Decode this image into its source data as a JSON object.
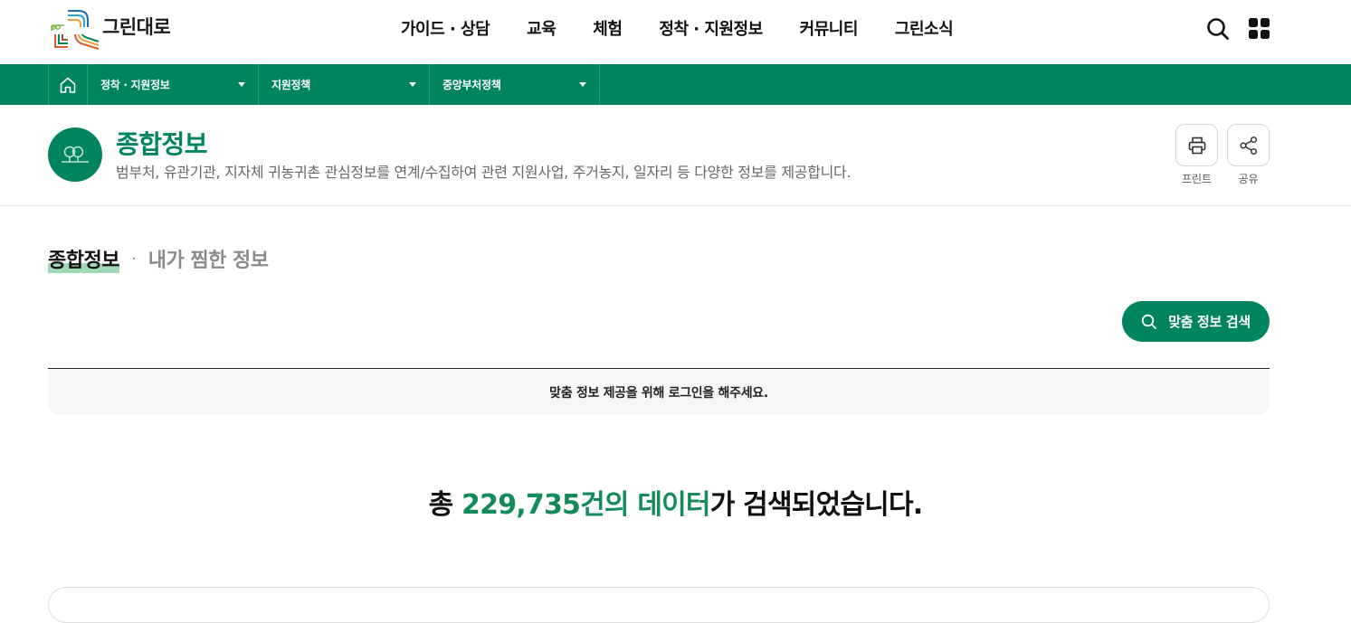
{
  "header": {
    "logo_text": "그린대로",
    "nav": [
      "가이드 · 상담",
      "교육",
      "체험",
      "정착 · 지원정보",
      "커뮤니티",
      "그린소식"
    ]
  },
  "location": {
    "items": [
      "정착 · 지원정보",
      "지원정책",
      "중앙부처정책"
    ]
  },
  "title": {
    "heading": "종합정보",
    "description": "범부처, 유관기관, 지자체 귀농귀촌 관심정보를 연계/수집하여 관련 지원사업, 주거농지, 일자리 등 다양한 정보를 제공합니다.",
    "print_label": "프린트",
    "share_label": "공유"
  },
  "tabs": {
    "active": "종합정보",
    "separator": "·",
    "inactive": "내가 찜한 정보"
  },
  "search_button_label": "맞춤 정보 검색",
  "notice": "맞춤 정보 제공을 위해 로그인을 해주세요.",
  "result": {
    "prefix": "총 ",
    "count": "229,735건의 데이터",
    "suffix": "가 검색되었습니다."
  },
  "colors": {
    "brand_green": "#00845f",
    "highlight": "#9ed8b6"
  }
}
